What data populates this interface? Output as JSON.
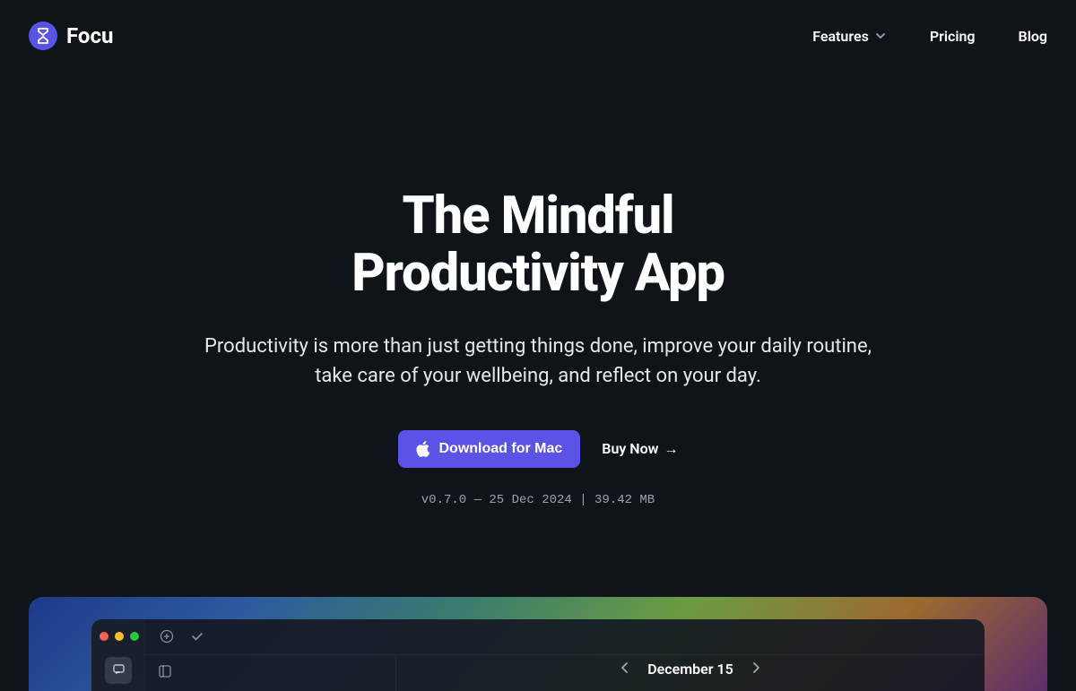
{
  "header": {
    "brand_name": "Focu",
    "nav": {
      "features_label": "Features",
      "pricing_label": "Pricing",
      "blog_label": "Blog"
    }
  },
  "hero": {
    "title_line1": "The Mindful",
    "title_line2": "Productivity App",
    "subtitle": "Productivity is more than just getting things done, improve your daily routine, take care of your wellbeing, and reflect on your day.",
    "download_label": "Download for Mac",
    "buy_label": "Buy Now",
    "version_text": "v0.7.0 — 25 Dec 2024 | 39.42 MB"
  },
  "screenshot": {
    "date_label": "December 15"
  }
}
